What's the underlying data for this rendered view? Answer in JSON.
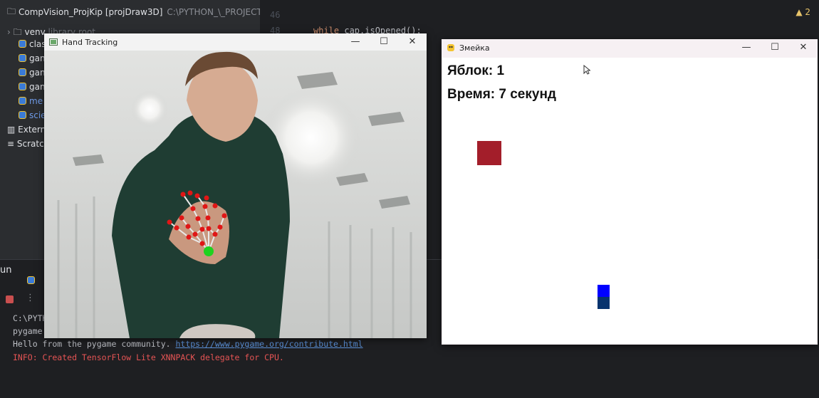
{
  "ide": {
    "project_title": "CompVision_ProjKip [projDraw3D]",
    "project_path": "C:\\PYTHON_\\_PROJECT_",
    "line_numbers": [
      "46",
      "48"
    ],
    "code_line": "while cap.isOpened():",
    "code_keyword": "while",
    "code_rest": " cap.isOpened():",
    "code_frag_top": "",
    "warning_count": "2",
    "tree": [
      {
        "name": "venv",
        "muted": "library root"
      },
      {
        "name": "clas"
      },
      {
        "name": "gan"
      },
      {
        "name": "gan"
      },
      {
        "name": "gan"
      },
      {
        "name": "me"
      },
      {
        "name": "scie"
      },
      {
        "name": "Extern"
      },
      {
        "name": "Scratc"
      }
    ],
    "run_tab": "un",
    "console": {
      "line1": "C:\\PYTH",
      "line2": "pygame",
      "line3_prefix": "Hello from the pygame community. ",
      "line3_link": "https://www.pygame.org/contribute.html",
      "line4": "INFO: Created TensorFlow Lite XNNPACK delegate for CPU."
    }
  },
  "hand_window": {
    "title": "Hand Tracking",
    "controls": {
      "minimize": "—",
      "maximize": "☐",
      "close": "✕"
    }
  },
  "snake_window": {
    "title": "Змейка",
    "controls": {
      "minimize": "—",
      "maximize": "☐",
      "close": "✕"
    },
    "score_text": "Яблок: 1",
    "time_text": "Время: 7 секунд",
    "colors": {
      "apple": "#a31e2a",
      "snake_head": "#0000ff",
      "snake_body": "#06336e",
      "background": "#ffffff"
    }
  }
}
